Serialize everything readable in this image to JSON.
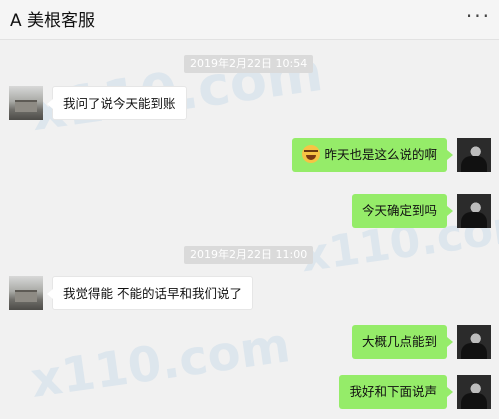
{
  "header": {
    "title": "A 美根客服",
    "more_label": "···"
  },
  "watermark": {
    "text": "x110.com",
    "count": 3
  },
  "messages": [
    {
      "type": "timestamp",
      "text": "2019年2月22日 10:54"
    },
    {
      "type": "message",
      "side": "left",
      "text": "我问了说今天能到账"
    },
    {
      "type": "message",
      "side": "right",
      "emoji": "laugh-cry",
      "text": "昨天也是这么说的啊"
    },
    {
      "type": "message",
      "side": "right",
      "text": "今天确定到吗"
    },
    {
      "type": "timestamp",
      "text": "2019年2月22日 11:00"
    },
    {
      "type": "message",
      "side": "left",
      "text": "我觉得能 不能的话早和我们说了"
    },
    {
      "type": "message",
      "side": "right",
      "text": "大概几点能到"
    },
    {
      "type": "message",
      "side": "right",
      "text": "我好和下面说声"
    }
  ]
}
